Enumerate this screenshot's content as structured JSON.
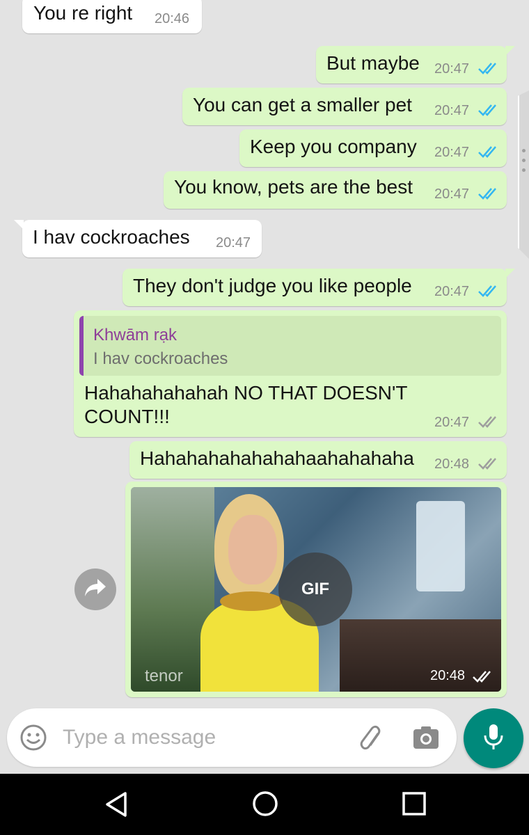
{
  "messages": [
    {
      "dir": "in",
      "text": "You re right",
      "time": "20:46"
    },
    {
      "dir": "out",
      "text": "But maybe",
      "time": "20:47",
      "status": "read"
    },
    {
      "dir": "out",
      "text": "You can get a smaller pet",
      "time": "20:47",
      "status": "read"
    },
    {
      "dir": "out",
      "text": "Keep you company",
      "time": "20:47",
      "status": "read"
    },
    {
      "dir": "out",
      "text": "You know, pets are the best",
      "time": "20:47",
      "status": "read"
    },
    {
      "dir": "in",
      "text": "I hav cockroaches",
      "time": "20:47"
    },
    {
      "dir": "out",
      "text": "They don't judge you like people",
      "time": "20:47",
      "status": "read"
    },
    {
      "dir": "out",
      "reply_to": {
        "author": "Khwām rạk",
        "text": "I hav cockroaches"
      },
      "text": "Hahahahahahah NO THAT DOESN'T COUNT!!!",
      "time": "20:47",
      "status": "delivered"
    },
    {
      "dir": "out",
      "text": "Hahahahahahahahaahahahaha",
      "time": "20:48",
      "status": "delivered"
    },
    {
      "dir": "out",
      "type": "gif",
      "badge": "GIF",
      "watermark": "tenor",
      "time": "20:48",
      "status": "delivered"
    }
  ],
  "composer": {
    "placeholder": "Type a message"
  },
  "icons": {
    "emoji": "emoji-icon",
    "attach": "paperclip-icon",
    "camera": "camera-icon",
    "mic": "microphone-icon",
    "forward": "forward-icon",
    "nav_back": "back-triangle-icon",
    "nav_home": "home-circle-icon",
    "nav_recent": "recents-square-icon"
  },
  "colors": {
    "outgoing_bubble": "#dcf8c6",
    "incoming_bubble": "#ffffff",
    "read_ticks": "#34b7f1",
    "delivered_ticks": "#9e9e9e",
    "accent": "#00897b",
    "reply_author": "#8e3e98"
  }
}
